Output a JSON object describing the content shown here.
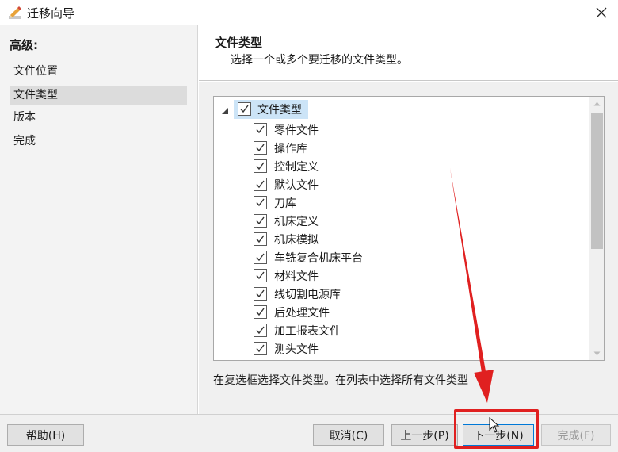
{
  "window": {
    "title": "迁移向导",
    "app_icon": "pencil-icon",
    "close_icon": "close-icon"
  },
  "left": {
    "heading": "高级:",
    "items": [
      {
        "label": "文件位置",
        "selected": false
      },
      {
        "label": "文件类型",
        "selected": true
      },
      {
        "label": "版本",
        "selected": false
      },
      {
        "label": "完成",
        "selected": false
      }
    ]
  },
  "header": {
    "title": "文件类型",
    "subtitle": "选择一个或多个要迁移的文件类型。"
  },
  "tree": {
    "root": {
      "label": "文件类型",
      "checked": true,
      "expanded": true
    },
    "items": [
      {
        "label": "零件文件",
        "checked": true
      },
      {
        "label": "操作库",
        "checked": true
      },
      {
        "label": "控制定义",
        "checked": true
      },
      {
        "label": "默认文件",
        "checked": true
      },
      {
        "label": "刀库",
        "checked": true
      },
      {
        "label": "机床定义",
        "checked": true
      },
      {
        "label": "机床模拟",
        "checked": true
      },
      {
        "label": "车铣复合机床平台",
        "checked": true
      },
      {
        "label": "材料文件",
        "checked": true
      },
      {
        "label": "线切割电源库",
        "checked": true
      },
      {
        "label": "后处理文件",
        "checked": true
      },
      {
        "label": "加工报表文件",
        "checked": true
      },
      {
        "label": "测头文件",
        "checked": true
      }
    ]
  },
  "hint": "在复选框选择文件类型。在列表中选择所有文件类型",
  "footer": {
    "help": "帮助(H)",
    "cancel": "取消(C)",
    "back": "上一步(P)",
    "next": "下一步(N)",
    "finish": "完成(F)"
  },
  "colors": {
    "annotation": "#e02020",
    "selection": "#cce4f7",
    "focus": "#0078d7"
  }
}
